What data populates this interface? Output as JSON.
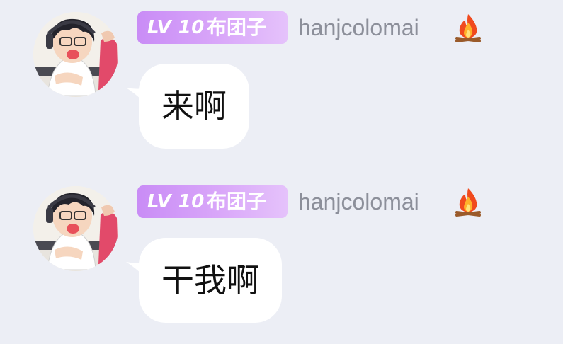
{
  "messages": [
    {
      "badge": {
        "level": "LV 10",
        "title": "布团子"
      },
      "username": "hanjcolomai",
      "text": "来啊"
    },
    {
      "badge": {
        "level": "LV 10",
        "title": "布团子"
      },
      "username": "hanjcolomai",
      "text": "干我啊"
    }
  ],
  "icons": {
    "flair": "fire-icon",
    "avatar": "anime-avatar"
  },
  "colors": {
    "background": "#eceef5",
    "badge_gradient_start": "#c98cf6",
    "badge_gradient_end": "#e5c2fb",
    "username": "#8c8f9a",
    "bubble": "#ffffff"
  }
}
